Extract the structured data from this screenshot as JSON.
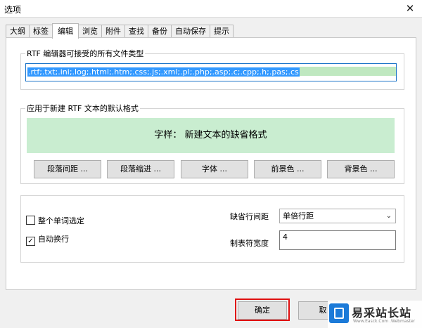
{
  "window": {
    "title": "选项",
    "close_glyph": "✕"
  },
  "tabs": [
    "大纲",
    "标签",
    "编辑",
    "浏览",
    "附件",
    "查找",
    "备份",
    "自动保存",
    "提示"
  ],
  "active_tab": "编辑",
  "rtf_types": {
    "legend": "RTF 编辑器可接受的所有文件类型",
    "value": ".rtf;.txt;.ini;.log;.html;.htm;.css;.js;.xml;.pl;.php;.asp;.c;.cpp;.h;.pas;.cs"
  },
  "default_format": {
    "legend": "应用于新建 RTF 文本的默认格式",
    "preview_text": "字样：  新建文本的缺省格式",
    "buttons": [
      "段落间距 ...",
      "段落缩进 ...",
      "字体 ...",
      "前景色 ...",
      "背景色 ..."
    ]
  },
  "options": {
    "whole_word": {
      "label": "整个单词选定",
      "checked": false
    },
    "word_wrap": {
      "label": "自动换行",
      "checked": true,
      "check_glyph": "✓"
    },
    "line_spacing_label": "缺省行间距",
    "line_spacing_value": "单倍行距",
    "tab_width_label": "制表符宽度",
    "tab_width_value": "4"
  },
  "footer": {
    "ok_label": "确定",
    "cancel_label": "取"
  },
  "watermark": {
    "brand": "易采站长站",
    "url": "Www.Easck.Com  .Webmaster"
  },
  "colors": {
    "highlight": "#e01010",
    "preview_bg": "#c9edd0",
    "selection": "#3399ff"
  }
}
